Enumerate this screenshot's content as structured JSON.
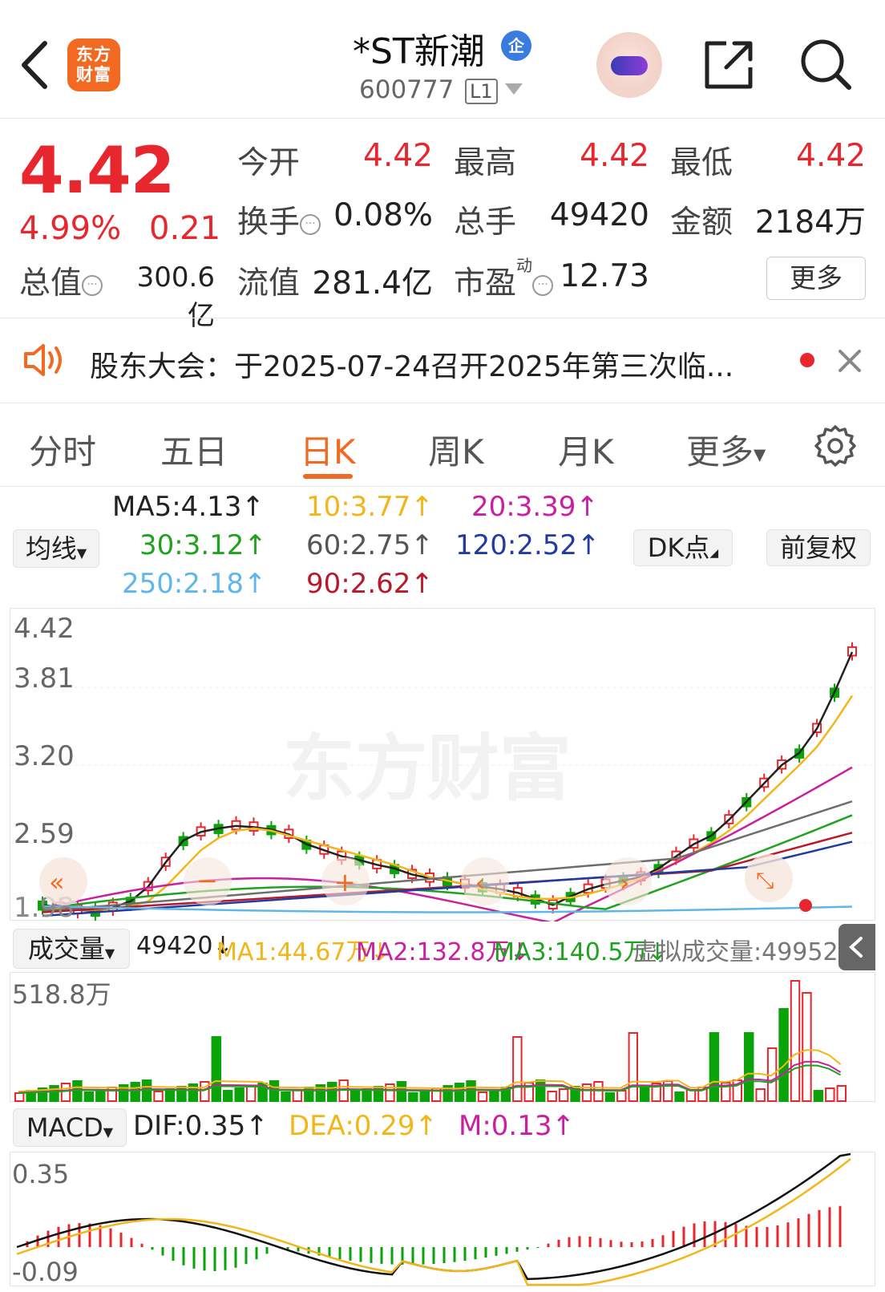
{
  "header": {
    "back_label": "",
    "logo_text_line1": "东方",
    "logo_text_line2": "财富",
    "title": "*ST新潮",
    "badge": "企",
    "code": "600777",
    "level": "L1"
  },
  "quote": {
    "price": "4.42",
    "change_pct": "4.99%",
    "change": "0.21",
    "open_label": "今开",
    "open": "4.42",
    "high_label": "最高",
    "high": "4.42",
    "low_label": "最低",
    "low": "4.42",
    "turnover_label": "换手",
    "turnover": "0.08%",
    "volume_label": "总手",
    "volume": "49420",
    "amount_label": "金额",
    "amount": "2184万",
    "mktcap_label": "总值",
    "mktcap": "300.6亿",
    "float_label": "流值",
    "float_cap": "281.4亿",
    "pe_label": "市盈",
    "pe_sup": "动",
    "pe": "12.73",
    "more_label": "更多"
  },
  "notice": {
    "text": "股东大会：于2025-07-24召开2025年第三次临..."
  },
  "tabs": [
    {
      "label": "分时"
    },
    {
      "label": "五日"
    },
    {
      "label": "日K",
      "active": true
    },
    {
      "label": "周K"
    },
    {
      "label": "月K"
    },
    {
      "label": "更多"
    }
  ],
  "ma_legend": {
    "selector": "均线",
    "ma5": "MA5:4.13↑",
    "ma10": "10:3.77↑",
    "ma20": "20:3.39↑",
    "ma30": "30:3.12↑",
    "ma60": "60:2.75↑",
    "ma120": "120:2.52↑",
    "ma250": "250:2.18↑",
    "ma90": "90:2.62↑",
    "dk_label": "DK点",
    "adjust_label": "前复权"
  },
  "colors": {
    "up": "#e8262e",
    "down": "#0aa30a",
    "ma5": "#222222",
    "ma10": "#f2b619",
    "ma20": "#c8209e",
    "ma30": "#1fa21f",
    "ma60": "#6e6e6e",
    "ma120": "#213ba3",
    "ma250": "#5fb6e8",
    "ma90": "#b8192b",
    "accent": "#f26a21"
  },
  "kline": {
    "y_labels": [
      "4.42",
      "3.81",
      "3.20",
      "2.59",
      "1.98"
    ],
    "watermark": "东方财富"
  },
  "volume": {
    "selector": "成交量",
    "value": "49420↓",
    "ma1": "MA1:44.67万↓",
    "ma2": "MA2:132.8万↓",
    "ma3": "MA3:140.5万↓",
    "virtual": "虚拟成交量:49952",
    "y_max": "518.8万"
  },
  "macd": {
    "selector": "MACD",
    "dif": "DIF:0.35↑",
    "dea": "DEA:0.29↑",
    "m": "M:0.13↑",
    "y_top": "0.35",
    "y_bottom": "-0.09"
  },
  "chart_data": {
    "type": "line",
    "title": "",
    "y_ticks": [
      4.42,
      3.81,
      3.2,
      2.59,
      1.98
    ],
    "ylim": [
      1.98,
      4.42
    ],
    "ma_lines": [
      {
        "name": "MA5",
        "color": "#222222",
        "values": [
          2.05,
          2.03,
          2.01,
          2.0,
          2.03,
          2.08,
          2.2,
          2.4,
          2.58,
          2.65,
          2.68,
          2.7,
          2.69,
          2.67,
          2.63,
          2.55,
          2.5,
          2.45,
          2.42,
          2.38,
          2.35,
          2.3,
          2.27,
          2.25,
          2.22,
          2.2,
          2.18,
          2.15,
          2.1,
          2.05,
          2.12,
          2.18,
          2.22,
          2.25,
          2.28,
          2.35,
          2.45,
          2.55,
          2.62,
          2.75,
          2.9,
          3.05,
          3.2,
          3.3,
          3.5,
          3.8,
          4.13
        ]
      },
      {
        "name": "MA10",
        "color": "#f2b619",
        "values": [
          2.02,
          2.02,
          2.01,
          2.01,
          2.02,
          2.04,
          2.08,
          2.2,
          2.35,
          2.5,
          2.6,
          2.66,
          2.68,
          2.66,
          2.62,
          2.58,
          2.54,
          2.5,
          2.46,
          2.42,
          2.38,
          2.33,
          2.28,
          2.25,
          2.22,
          2.18,
          2.15,
          2.12,
          2.1,
          2.1,
          2.11,
          2.14,
          2.18,
          2.22,
          2.27,
          2.33,
          2.4,
          2.48,
          2.56,
          2.66,
          2.78,
          2.92,
          3.06,
          3.2,
          3.35,
          3.55,
          3.77
        ]
      }
    ]
  }
}
